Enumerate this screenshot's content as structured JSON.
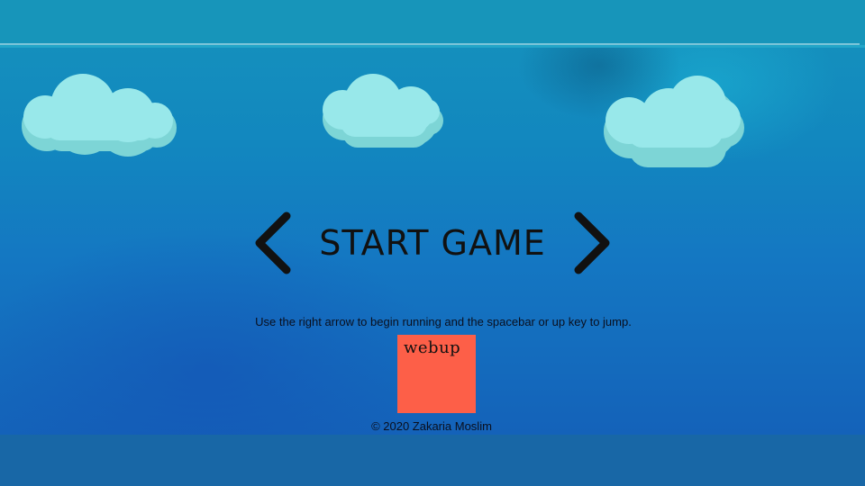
{
  "menu": {
    "start_label": "START GAME",
    "prev_arrow_icon": "chevron-left-icon",
    "next_arrow_icon": "chevron-right-icon"
  },
  "instructions": "Use the right arrow to begin running and the spacebar or up key to jump.",
  "logo": {
    "text": "webup",
    "color": "#fd5f48"
  },
  "footer": {
    "copyright": "© 2020 Zakaria Moslim"
  },
  "scene": {
    "cloud_icon": "cloud-icon",
    "sky_top_color": "#148fbd",
    "sky_bottom_color": "#1462b9",
    "cloud_color": "#98e8ea",
    "cloud_shadow_color": "#7dd5d6"
  }
}
